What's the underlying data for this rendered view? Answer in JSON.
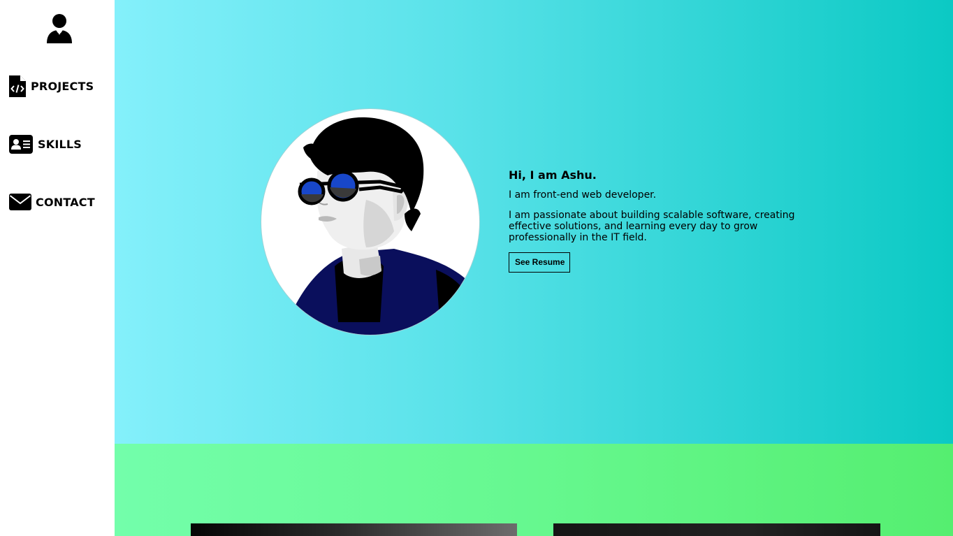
{
  "sidebar": {
    "logo_icon": "businessman-icon",
    "items": [
      {
        "label": "PROJECTS",
        "icon": "code-file-icon"
      },
      {
        "label": "SKILLS",
        "icon": "id-card-icon"
      },
      {
        "label": "CONTACT",
        "icon": "envelope-icon"
      }
    ]
  },
  "hero": {
    "greeting": "Hi, I am Ashu.",
    "role": "I am front-end web developer.",
    "bio": "I am passionate about building scalable software, creating effective solutions, and learning every day to grow professionally in the IT field.",
    "resume_button": "See Resume",
    "avatar": "profile-illustration"
  },
  "colors": {
    "hero_gradient": [
      "#84f0fb",
      "#0bc9c4"
    ],
    "projects_gradient": [
      "#73feab",
      "#55ee70"
    ],
    "text": "#000000",
    "jacket": "#0a0f5c",
    "lens": "#1847c9"
  }
}
